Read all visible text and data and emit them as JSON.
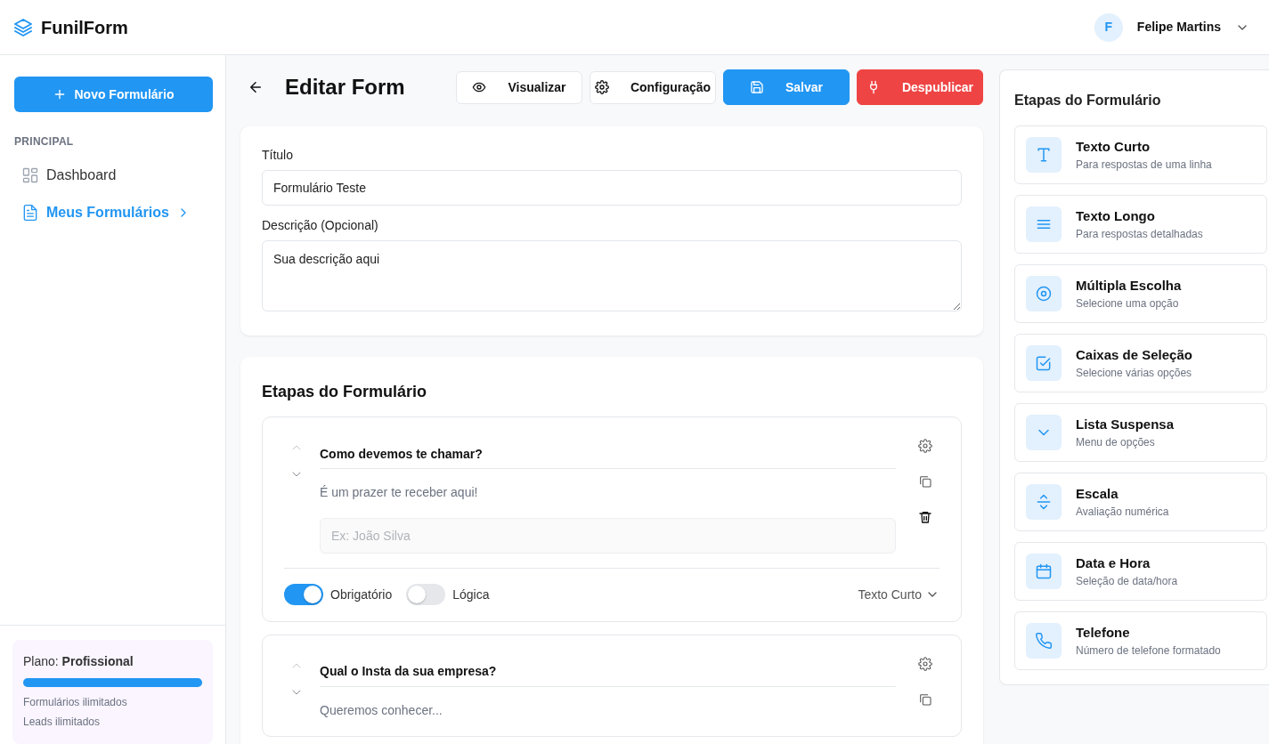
{
  "app": {
    "name": "FunilForm"
  },
  "user": {
    "initial": "F",
    "name": "Felipe Martins"
  },
  "sidebar": {
    "new_button": "Novo Formulário",
    "section": "PRINCIPAL",
    "items": [
      {
        "label": "Dashboard",
        "selected": false
      },
      {
        "label": "Meus Formulários",
        "selected": true
      }
    ],
    "plan": {
      "label": "Plano: **Profissional**",
      "level": 1,
      "features": [
        "Formulários ilimitados",
        "Leads ilimitados"
      ]
    }
  },
  "editor": {
    "title": "Editar Form",
    "actions": [
      {
        "label": "Visualizar",
        "kind": "preview"
      },
      {
        "label": "Configuração",
        "kind": "settings"
      },
      {
        "label": "Salvar",
        "kind": "save"
      },
      {
        "label": "Despublicar",
        "kind": "unpublish"
      }
    ]
  },
  "details": {
    "title_label": "Título",
    "title_value": "Formulário Teste",
    "description_label": "Descrição (Opcional)",
    "description_value": "Sua descrição aqui"
  },
  "steps": {
    "title": "Etapas do Formulário",
    "items": [
      {
        "question": "Como devemos te chamar?",
        "description": "É um prazer te receber aqui!",
        "placeholder": "Ex: João Silva",
        "toggles": [
          {
            "label": "Obrigatório",
            "on": true
          },
          {
            "label": "Lógica",
            "on": false
          }
        ],
        "type": "Texto Curto"
      },
      {
        "question": "Qual o Insta da sua empresa?",
        "description": "Queremos conhecer..."
      }
    ]
  },
  "palette": {
    "title": "Etapas do Formulário",
    "items": [
      {
        "kind": "short_text",
        "title": "Texto Curto",
        "subtitle": "Para respostas de uma linha"
      },
      {
        "kind": "long_text",
        "title": "Texto Longo",
        "subtitle": "Para respostas detalhadas"
      },
      {
        "kind": "radio",
        "title": "Múltipla Escolha",
        "subtitle": "Selecione uma opção"
      },
      {
        "kind": "checkbox",
        "title": "Caixas de Seleção",
        "subtitle": "Selecione várias opções"
      },
      {
        "kind": "dropdown",
        "title": "Lista Suspensa",
        "subtitle": "Menu de opções"
      },
      {
        "kind": "scale",
        "title": "Escala",
        "subtitle": "Avaliação numérica"
      },
      {
        "kind": "datetime",
        "title": "Data e Hora",
        "subtitle": "Seleção de data/hora"
      },
      {
        "kind": "phone",
        "title": "Telefone",
        "subtitle": "Número de telefone formatado"
      }
    ]
  }
}
